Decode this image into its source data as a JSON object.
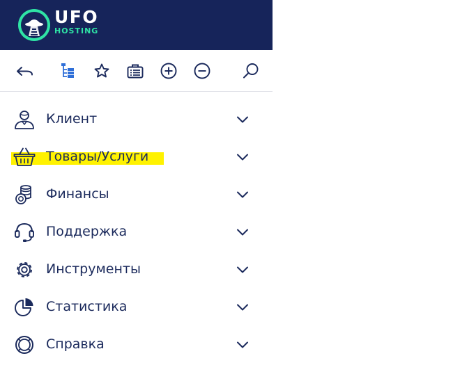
{
  "brand": {
    "name_line1": "UFO",
    "name_line2": "HOSTING",
    "colors": {
      "header_bg": "#16245a",
      "logo_accent": "#2fe3a5",
      "text_primary": "#1b2a5c",
      "toolbar_accent": "#2f6fd8",
      "highlight": "#fff200"
    }
  },
  "toolbar": {
    "buttons": [
      {
        "icon": "back-arrow-icon"
      },
      {
        "icon": "tree-icon"
      },
      {
        "icon": "star-icon"
      },
      {
        "icon": "briefcase-icon"
      },
      {
        "icon": "plus-circle-icon"
      },
      {
        "icon": "minus-circle-icon"
      },
      {
        "icon": "search-icon"
      }
    ]
  },
  "menu": {
    "items": [
      {
        "label": "Клиент",
        "icon": "user-icon",
        "highlighted": false
      },
      {
        "label": "Товары/Услуги",
        "icon": "basket-icon",
        "highlighted": true
      },
      {
        "label": "Финансы",
        "icon": "coins-icon",
        "highlighted": false
      },
      {
        "label": "Поддержка",
        "icon": "headset-icon",
        "highlighted": false
      },
      {
        "label": "Инструменты",
        "icon": "gear-icon",
        "highlighted": false
      },
      {
        "label": "Статистика",
        "icon": "pie-chart-icon",
        "highlighted": false
      },
      {
        "label": "Справка",
        "icon": "lifebuoy-icon",
        "highlighted": false
      }
    ]
  }
}
